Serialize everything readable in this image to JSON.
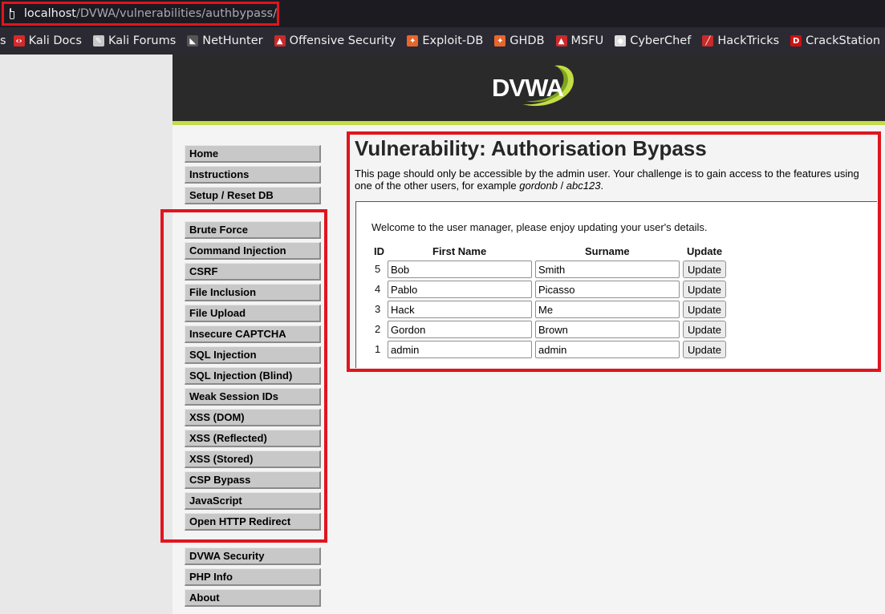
{
  "browser": {
    "url_host": "localhost",
    "url_path": "/DVWA/vulnerabilities/authbypass/",
    "bookmarks": [
      {
        "label": "s",
        "icon": "truncated-icon"
      },
      {
        "label": "Kali Docs",
        "icon": "kali-docs-icon",
        "color": "#d42a2a"
      },
      {
        "label": "Kali Forums",
        "icon": "kali-dragon-icon",
        "color": "#c8c8c8"
      },
      {
        "label": "NetHunter",
        "icon": "nethunter-icon",
        "color": "#555555"
      },
      {
        "label": "Offensive Security",
        "icon": "offsec-icon",
        "color": "#c92a2a"
      },
      {
        "label": "Exploit-DB",
        "icon": "exploit-db-icon",
        "color": "#e8662a"
      },
      {
        "label": "GHDB",
        "icon": "ghdb-icon",
        "color": "#e8662a"
      },
      {
        "label": "MSFU",
        "icon": "msfu-icon",
        "color": "#c92a2a"
      },
      {
        "label": "CyberChef",
        "icon": "cyberchef-icon",
        "color": "#dddddd"
      },
      {
        "label": "HackTricks",
        "icon": "hacktricks-icon",
        "color": "#c92a2a"
      },
      {
        "label": "CrackStation",
        "icon": "crackstation-icon",
        "color": "#d01010"
      }
    ]
  },
  "app": {
    "logo_text": "DVWA",
    "accent_color": "#c4dd45"
  },
  "menu": {
    "group1": [
      "Home",
      "Instructions",
      "Setup / Reset DB"
    ],
    "group2": [
      "Brute Force",
      "Command Injection",
      "CSRF",
      "File Inclusion",
      "File Upload",
      "Insecure CAPTCHA",
      "SQL Injection",
      "SQL Injection (Blind)",
      "Weak Session IDs",
      "XSS (DOM)",
      "XSS (Reflected)",
      "XSS (Stored)",
      "CSP Bypass",
      "JavaScript",
      "Open HTTP Redirect"
    ],
    "group3": [
      "DVWA Security",
      "PHP Info",
      "About"
    ]
  },
  "content": {
    "title": "Vulnerability: Authorisation Bypass",
    "intro_part1": "This page should only be accessible by the admin user. Your challenge is to gain access to the features using one of the other users, for example ",
    "intro_user": "gordonb",
    "intro_sep": " / ",
    "intro_pass": "abc123",
    "intro_end": ".",
    "welcome": "Welcome to the user manager, please enjoy updating your user's details.",
    "table": {
      "headers": {
        "id": "ID",
        "first_name": "First Name",
        "surname": "Surname",
        "update": "Update"
      },
      "rows": [
        {
          "id": "5",
          "first_name": "Bob",
          "surname": "Smith",
          "button": "Update"
        },
        {
          "id": "4",
          "first_name": "Pablo",
          "surname": "Picasso",
          "button": "Update"
        },
        {
          "id": "3",
          "first_name": "Hack",
          "surname": "Me",
          "button": "Update"
        },
        {
          "id": "2",
          "first_name": "Gordon",
          "surname": "Brown",
          "button": "Update"
        },
        {
          "id": "1",
          "first_name": "admin",
          "surname": "admin",
          "button": "Update"
        }
      ]
    }
  }
}
